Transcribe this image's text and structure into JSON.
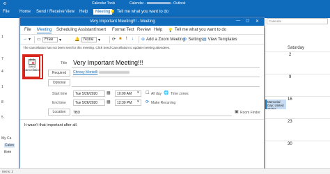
{
  "outlook": {
    "tabs": [
      "File",
      "Home",
      "Send / Receive",
      "View",
      "Help"
    ],
    "calendar_tools": "Calendar Tools",
    "meeting_tab": "Meeting",
    "window_title": "Calendar - ",
    "window_title_suffix": " - Outlook",
    "search_placeholder": "Tell me what you want to do",
    "left_numbers": [
      "1",
      "7",
      "4",
      "1",
      "8",
      "5"
    ],
    "my_calendars": "My Ca",
    "calendar_label": "Calen",
    "birthdays_label": "Birth",
    "items_label": "Items: 2",
    "saturday": "Saturday",
    "day_numbers": [
      "2",
      "9",
      "16",
      "23",
      "30"
    ],
    "event_text": "Memorial Day; United States",
    "calendar_search": "Calendar"
  },
  "meeting_window": {
    "title": "Very Important Meeting!!! - Meeting",
    "tabs": [
      "File",
      "Meeting",
      "Scheduling Assistant",
      "Insert",
      "Format Text",
      "Review",
      "Help"
    ],
    "tell_me": "Tell me what you want to do",
    "toolbar": {
      "show_as": "Free",
      "reminder": "None",
      "add_zoom": "Add a Zoom Meeting",
      "settings": "Settings",
      "view_templates": "View Templates"
    },
    "info_bar": "The cancellation has not been sent for this meeting. Click Send Cancellation to update meeting attendees.",
    "send_cancellation": "Send Cancellation",
    "title_label": "Title",
    "subject": "Very Important Meeting!!!",
    "required_label": "Required",
    "required_value": "Chrissy Montelli",
    "optional_label": "Optional",
    "start_time_label": "Start time",
    "end_time_label": "End time",
    "start_date": "Tue 5/26/2020",
    "start_time": "10:00 AM",
    "end_date": "Tue 5/26/2020",
    "end_time": "12:30 PM",
    "all_day": "All day",
    "time_zones": "Time zones",
    "make_recurring": "Make Recurring",
    "location_label": "Location",
    "location_value": "TBD",
    "room_finder": "Room Finder",
    "body": "It wasn't that important after all."
  },
  "colors": {
    "accent": "#0f6cbd",
    "highlight": "#d9261c"
  }
}
